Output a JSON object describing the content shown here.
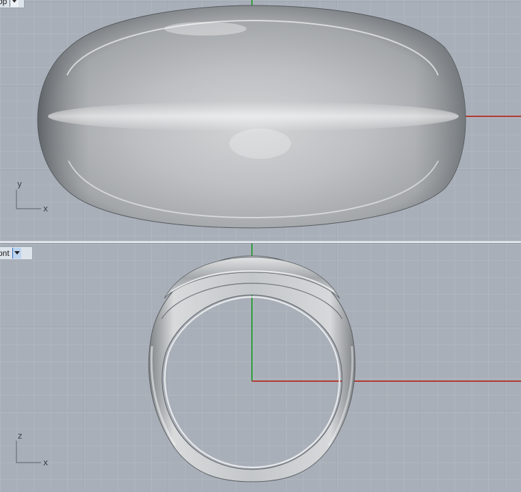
{
  "viewports": {
    "top": {
      "label": "Top",
      "label_visible": "op",
      "axis_vertical": "y",
      "axis_horizontal": "x"
    },
    "front": {
      "label": "Front",
      "label_visible": "ont",
      "axis_vertical": "z",
      "axis_horizontal": "x"
    }
  },
  "colors": {
    "background": "#a9afb8",
    "grid_minor": "#b4bac3",
    "grid_major": "#9aa1ab",
    "x_axis": "#b23a32",
    "y_axis": "#2e9a3a",
    "model_surface": "#c9cccf"
  },
  "icons": {
    "viewport_menu": "dropdown-arrow-icon"
  }
}
